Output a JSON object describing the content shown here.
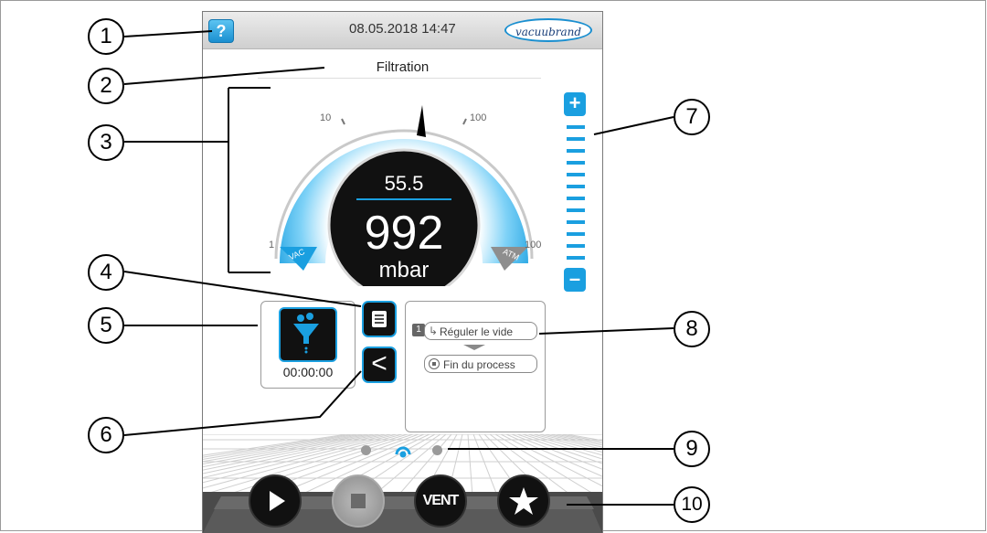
{
  "header": {
    "help_label": "?",
    "datetime": "08.05.2018  14:47",
    "logo_text": "vacuubrand"
  },
  "title": "Filtration",
  "gauge": {
    "setpoint": "55.5",
    "pressure": "992",
    "unit": "mbar",
    "scale_labels": [
      "1",
      "10",
      "100",
      "1000"
    ],
    "vac_label": "VAC",
    "atm_label": "ATM",
    "setpoint_level": 0.63,
    "accent": "#1a9fe0"
  },
  "stepper": {
    "plus": "+",
    "minus": "–",
    "segments": 12
  },
  "timer": "00:00:00",
  "process": {
    "step_number": "1",
    "step_label": "Réguler le vide",
    "end_label": "Fin du process"
  },
  "pagination": {
    "pages": 3,
    "active": 1
  },
  "controls": {
    "vent_label": "VENT"
  },
  "callouts": [
    "1",
    "2",
    "3",
    "4",
    "5",
    "6",
    "7",
    "8",
    "9",
    "10"
  ]
}
